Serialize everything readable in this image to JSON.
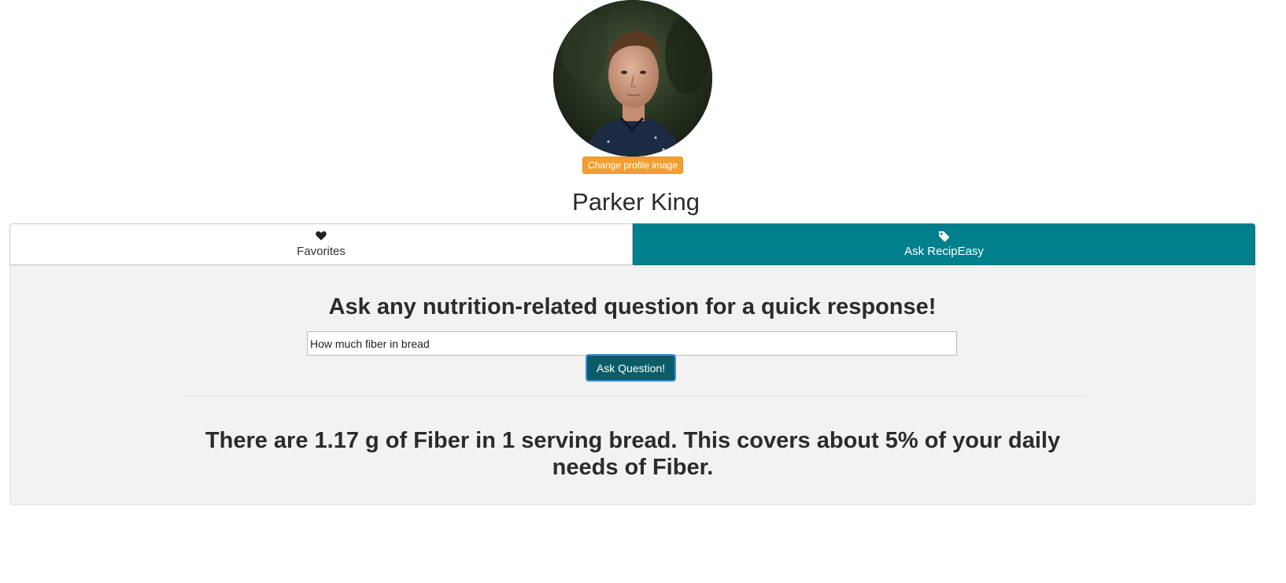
{
  "profile": {
    "avatar_icon": "profile-photo",
    "change_image_label": "Change profile image",
    "name": "Parker King"
  },
  "tabs": [
    {
      "label": "Favorites",
      "icon": "heart-icon",
      "active": false
    },
    {
      "label": "Ask RecipEasy",
      "icon": "tag-icon",
      "active": true
    }
  ],
  "ask": {
    "heading": "Ask any nutrition-related question for a quick response!",
    "input_value": "How much fiber in bread",
    "button_label": "Ask Question!",
    "answer": "There are 1.17 g of Fiber in 1 serving bread. This covers about 5% of your daily needs of Fiber."
  },
  "colors": {
    "accent_teal": "#00808d",
    "button_dark_teal": "#0a5d68",
    "change_image_orange": "#f0a030",
    "panel_bg": "#f2f2f2"
  }
}
